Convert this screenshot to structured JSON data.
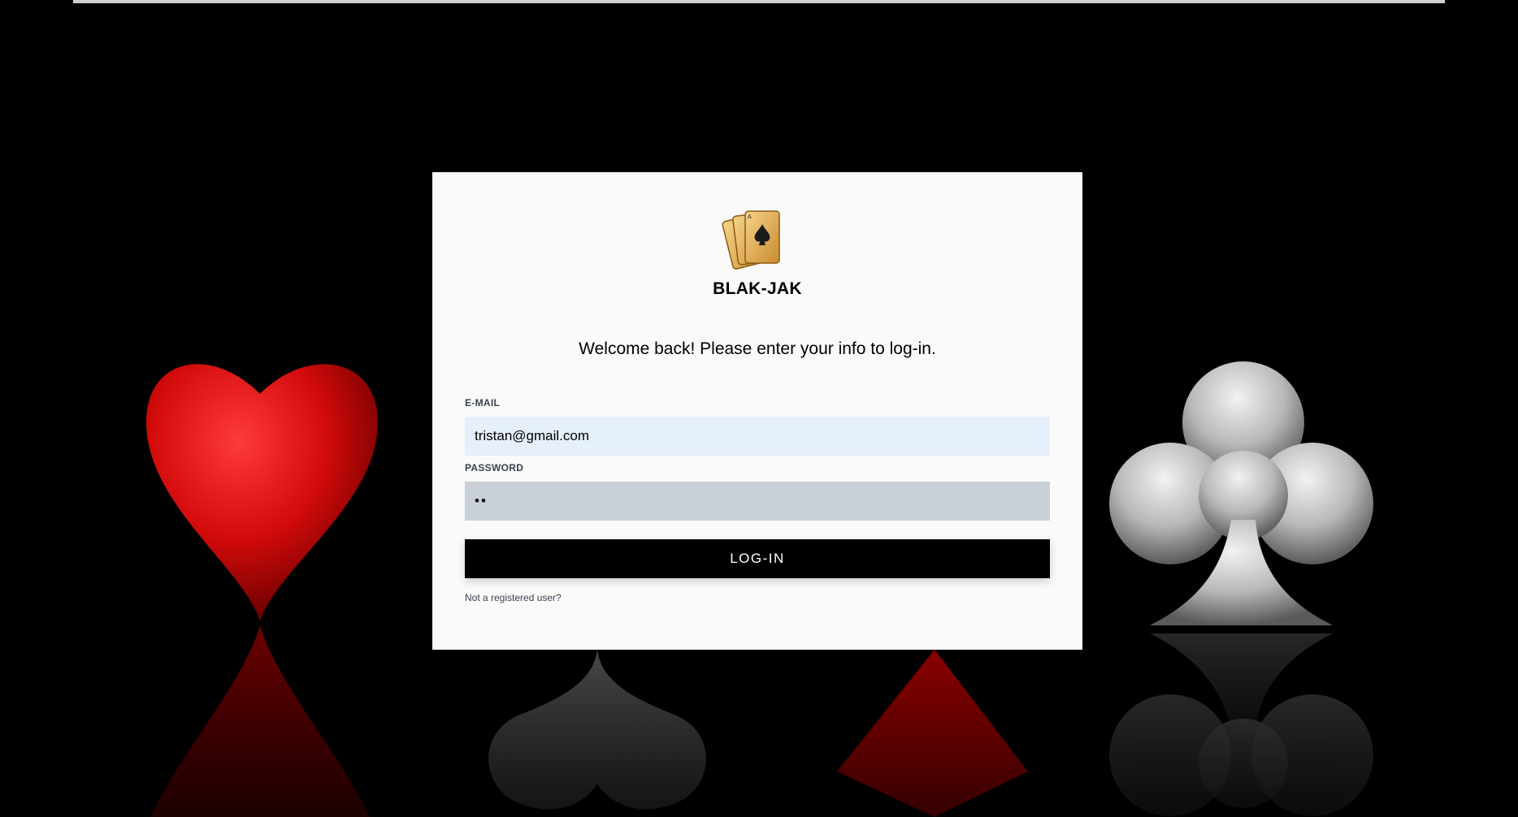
{
  "app": {
    "brand": "BLAK-JAK"
  },
  "login": {
    "welcome": "Welcome back! Please enter your info to log-in.",
    "email_label": "E-MAIL",
    "email_value": "tristan@gmail.com",
    "password_label": "PASSWORD",
    "password_value": "••",
    "button_label": "LOG-IN",
    "register_text": "Not a registered user?"
  },
  "icons": {
    "logo": "playing-cards-logo-icon",
    "background_suits": [
      "heart-icon",
      "spade-icon",
      "diamond-icon",
      "club-icon"
    ]
  },
  "colors": {
    "heart": "#d10a0a",
    "club": "#c9c9c9",
    "card_bg": "#fafaf9",
    "email_bg": "#e6effc",
    "password_bg": "#c9cfd6",
    "button_bg": "#000000"
  }
}
